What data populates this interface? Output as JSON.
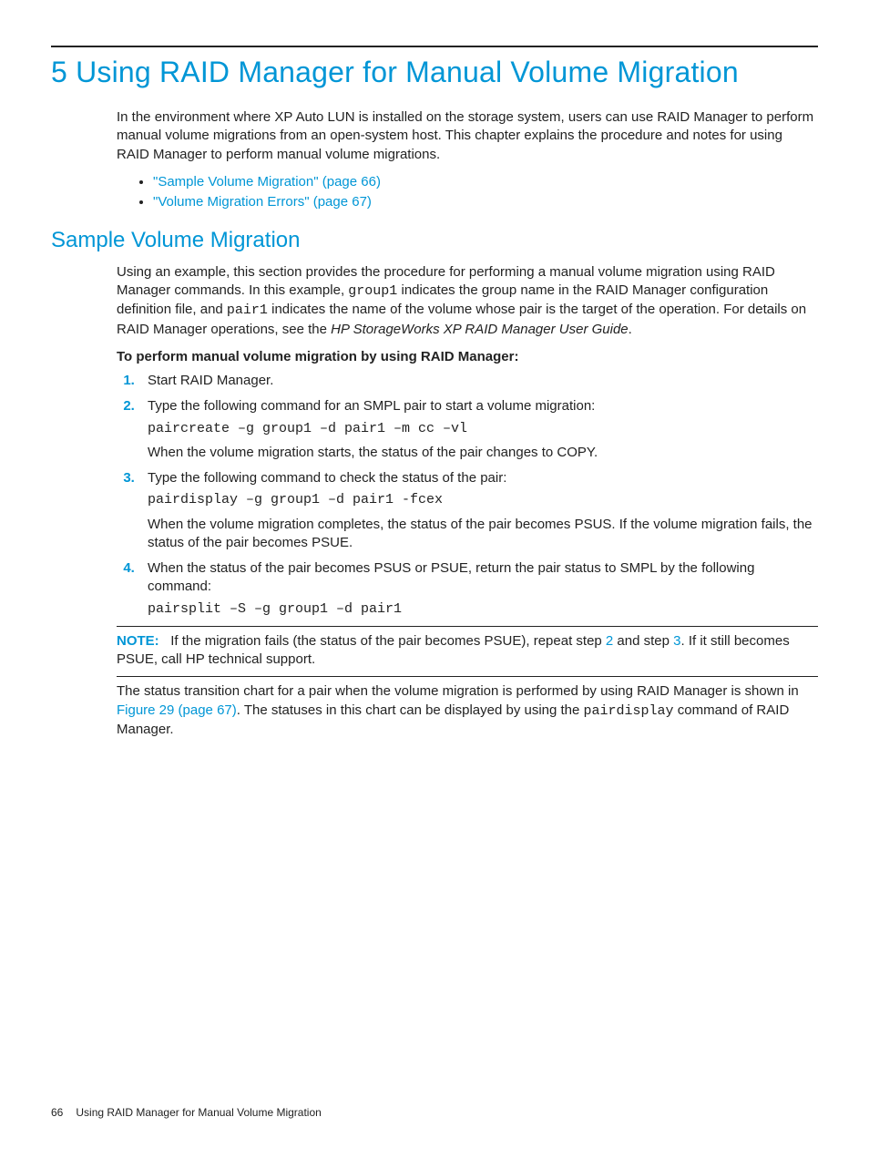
{
  "chapter": {
    "title": "5 Using RAID Manager for Manual Volume Migration",
    "intro": "In the environment where XP Auto LUN is installed on the storage system, users can use RAID Manager to perform manual volume migrations from an open-system host. This chapter explains the procedure and notes for using RAID Manager to perform manual volume migrations.",
    "toc": [
      "\"Sample Volume Migration\" (page 66)",
      "\"Volume Migration Errors\" (page 67)"
    ]
  },
  "section1": {
    "title": "Sample Volume Migration",
    "para_pre": "Using an example, this section provides the procedure for performing a manual volume migration using RAID Manager commands. In this example, ",
    "code1": "group1",
    "para_mid1": " indicates the group name in the RAID Manager configuration definition file, and ",
    "code2": "pair1",
    "para_mid2": " indicates the name of the volume whose pair is the target of the operation. For details on RAID Manager operations, see the ",
    "ref_italic": "HP StorageWorks XP RAID Manager User Guide",
    "para_end": ".",
    "procedure_heading": "To perform manual volume migration by using RAID Manager:",
    "steps": {
      "s1": "Start RAID Manager.",
      "s2": {
        "text": "Type the following command for an SMPL pair to start a volume migration:",
        "cmd": "paircreate –g group1 –d pair1 –m cc –vl",
        "after": "When the volume migration starts, the status of the pair changes to COPY."
      },
      "s3": {
        "text": "Type the following command to check the status of the pair:",
        "cmd": "pairdisplay –g group1 –d pair1 -fcex",
        "after": "When the volume migration completes, the status of the pair becomes PSUS. If the volume migration fails, the status of the pair becomes PSUE."
      },
      "s4": {
        "text": "When the status of the pair becomes PSUS or PSUE, return the pair status to SMPL by the following command:",
        "cmd": "pairsplit –S –g group1 –d pair1"
      }
    },
    "note": {
      "label": "NOTE:",
      "t1": "If the migration fails (the status of the pair becomes PSUE), repeat step ",
      "link2": "2",
      "t2": " and step ",
      "link3": "3",
      "t3": ". If it still becomes PSUE, call HP technical support."
    },
    "closing": {
      "t1": "The status transition chart for a pair when the volume migration is performed by using RAID Manager is shown in ",
      "fig_link": "Figure 29 (page 67)",
      "t2": ". The statuses in this chart can be displayed by using the ",
      "code": "pairdisplay",
      "t3": " command of RAID Manager."
    }
  },
  "footer": {
    "page": "66",
    "title": "Using RAID Manager for Manual Volume Migration"
  }
}
